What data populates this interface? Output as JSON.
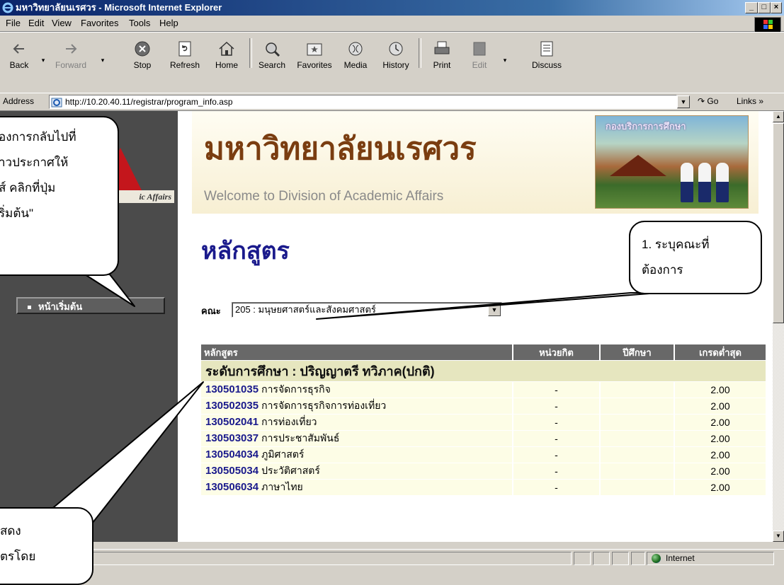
{
  "window": {
    "title": "มหาวิทยาลัยนเรศวร - Microsoft Internet Explorer"
  },
  "menu": [
    "File",
    "Edit",
    "View",
    "Favorites",
    "Tools",
    "Help"
  ],
  "toolbar": {
    "back": "Back",
    "forward": "Forward",
    "stop": "Stop",
    "refresh": "Refresh",
    "home": "Home",
    "search": "Search",
    "favorites": "Favorites",
    "media": "Media",
    "history": "History",
    "print": "Print",
    "edit": "Edit",
    "discuss": "Discuss"
  },
  "address": {
    "label": "Address",
    "url": "http://10.20.40.11/registrar/program_info.asp",
    "go": "Go",
    "links": "Links »"
  },
  "sidebar": {
    "academic_affairs": "ic Affairs",
    "home_button": "หน้าเริ่มต้น"
  },
  "banner": {
    "title": "มหาวิทยาลัยนเรศวร",
    "subtitle": "Welcome to Division of Academic Affairs",
    "photo_label": "กองบริการการศึกษา"
  },
  "page": {
    "heading": "หลักสูตร",
    "faculty_label": "คณะ",
    "faculty_value": "205 : มนุษยศาสตร์และสังคมศาสตร์"
  },
  "table": {
    "headers": [
      "หลักสูตร",
      "หน่วยกิต",
      "ปีศึกษา",
      "เกรดต่ำสุด"
    ],
    "level": "ระดับการศึกษา : ปริญญาตรี ทวิภาค(ปกติ)",
    "rows": [
      {
        "code": "130501035",
        "name": "การจัดการธุรกิจ",
        "credits": "-",
        "year": "",
        "min_grade": "2.00"
      },
      {
        "code": "130502035",
        "name": "การจัดการธุรกิจการท่องเที่ยว",
        "credits": "-",
        "year": "",
        "min_grade": "2.00"
      },
      {
        "code": "130502041",
        "name": "การท่องเที่ยว",
        "credits": "-",
        "year": "",
        "min_grade": "2.00"
      },
      {
        "code": "130503037",
        "name": "การประชาสัมพันธ์",
        "credits": "-",
        "year": "",
        "min_grade": "2.00"
      },
      {
        "code": "130504034",
        "name": "ภูมิศาสตร์",
        "credits": "-",
        "year": "",
        "min_grade": "2.00"
      },
      {
        "code": "130505034",
        "name": "ประวัติศาสตร์",
        "credits": "-",
        "year": "",
        "min_grade": "2.00"
      },
      {
        "code": "130506034",
        "name": "ภาษาไทย",
        "credits": "-",
        "year": "",
        "min_grade": "2.00"
      }
    ]
  },
  "status": {
    "zone": "Internet"
  },
  "callouts": {
    "left_top": [
      "้องการกลับไปที่",
      "าวประกาศให้",
      "ส์ คลิกที่ปุ่ม",
      "ริ่มต้น\""
    ],
    "right": [
      "1. ระบุคณะที่",
      "ต้องการ"
    ],
    "bottom": [
      "สดง",
      "ตรโดย"
    ]
  },
  "colors": {
    "title_bar": "#0a246a",
    "sidebar": "#4b4b4b",
    "heading": "#1a1a8c",
    "banner_title": "#7a3d10",
    "table_header": "#686868",
    "table_row": "#fdfde6",
    "level_row": "#e6e6bf",
    "brand_red": "#c4161c"
  },
  "icons": {
    "back": "back-arrow-icon",
    "forward": "forward-arrow-icon",
    "stop": "stop-icon",
    "refresh": "refresh-icon",
    "home": "home-icon",
    "search": "search-icon",
    "favorites": "favorites-icon",
    "media": "media-icon",
    "history": "history-icon",
    "print": "print-icon",
    "edit": "edit-icon",
    "discuss": "discuss-icon"
  }
}
